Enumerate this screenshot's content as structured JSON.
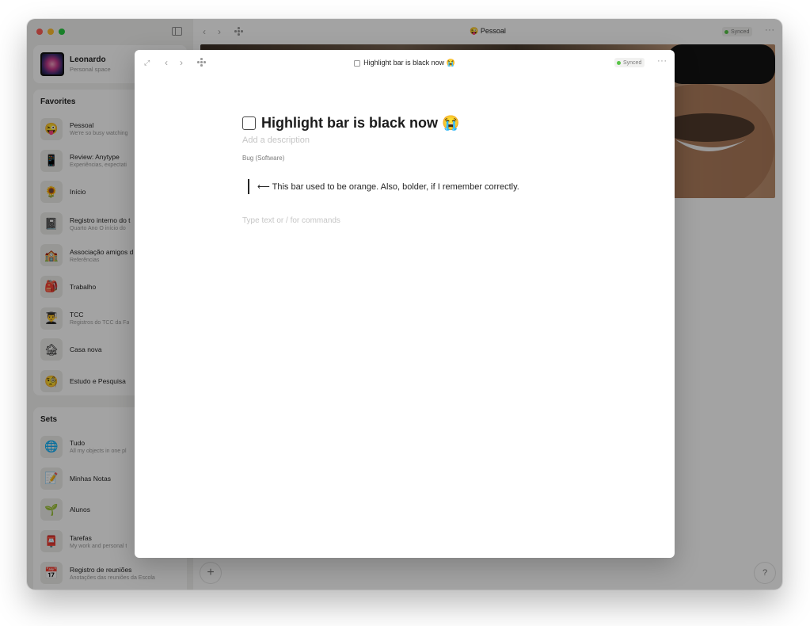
{
  "sidebar": {
    "profile": {
      "name": "Leonardo",
      "subtitle": "Personal space"
    },
    "favorites": {
      "title": "Favorites",
      "items": [
        {
          "title": "Pessoal",
          "subtitle": "We're so busy watching",
          "icon": "😜"
        },
        {
          "title": "Review: Anytype",
          "subtitle": "Experiências, expectati",
          "icon": "📱"
        },
        {
          "title": "Início",
          "subtitle": "",
          "icon": "🌻"
        },
        {
          "title": "Registro interno do t",
          "subtitle": "Quarto Ano O início do",
          "icon": "📓"
        },
        {
          "title": "Associação amigos d",
          "subtitle": "Referências",
          "icon": "🏫"
        },
        {
          "title": "Trabalho",
          "subtitle": "",
          "icon": "🎒"
        },
        {
          "title": "TCC",
          "subtitle": "Registros do TCC da Fa",
          "icon": "👨‍🎓"
        },
        {
          "title": "Casa nova",
          "subtitle": "",
          "icon": "🏚"
        },
        {
          "title": "Estudo e Pesquisa",
          "subtitle": "",
          "icon": "🧐"
        }
      ]
    },
    "sets": {
      "title": "Sets",
      "items": [
        {
          "title": "Tudo",
          "subtitle": "All my objects in one pl",
          "icon": "🌐"
        },
        {
          "title": "Minhas Notas",
          "subtitle": "",
          "icon": "📝"
        },
        {
          "title": "Alunos",
          "subtitle": "",
          "icon": "🌱"
        },
        {
          "title": "Tarefas",
          "subtitle": "My work and personal t",
          "icon": "📮"
        },
        {
          "title": "Registro de reuniões",
          "subtitle": "Anotações das reuniões da Escola",
          "icon": "📅"
        }
      ]
    }
  },
  "main": {
    "title": "😜 Pessoal",
    "synced_label": "Synced",
    "more_label": "···",
    "add_label": "+",
    "help_label": "?"
  },
  "modal": {
    "header_title": "Highlight bar is black now 😭",
    "synced_label": "Synced",
    "more_label": "···",
    "title": "Highlight bar is black now 😭",
    "description_placeholder": "Add a description",
    "object_type": "Bug (Software)",
    "quote_text": "⟵ This bar used to be orange. Also, bolder, if I remember correctly.",
    "body_placeholder": "Type text or / for commands"
  }
}
